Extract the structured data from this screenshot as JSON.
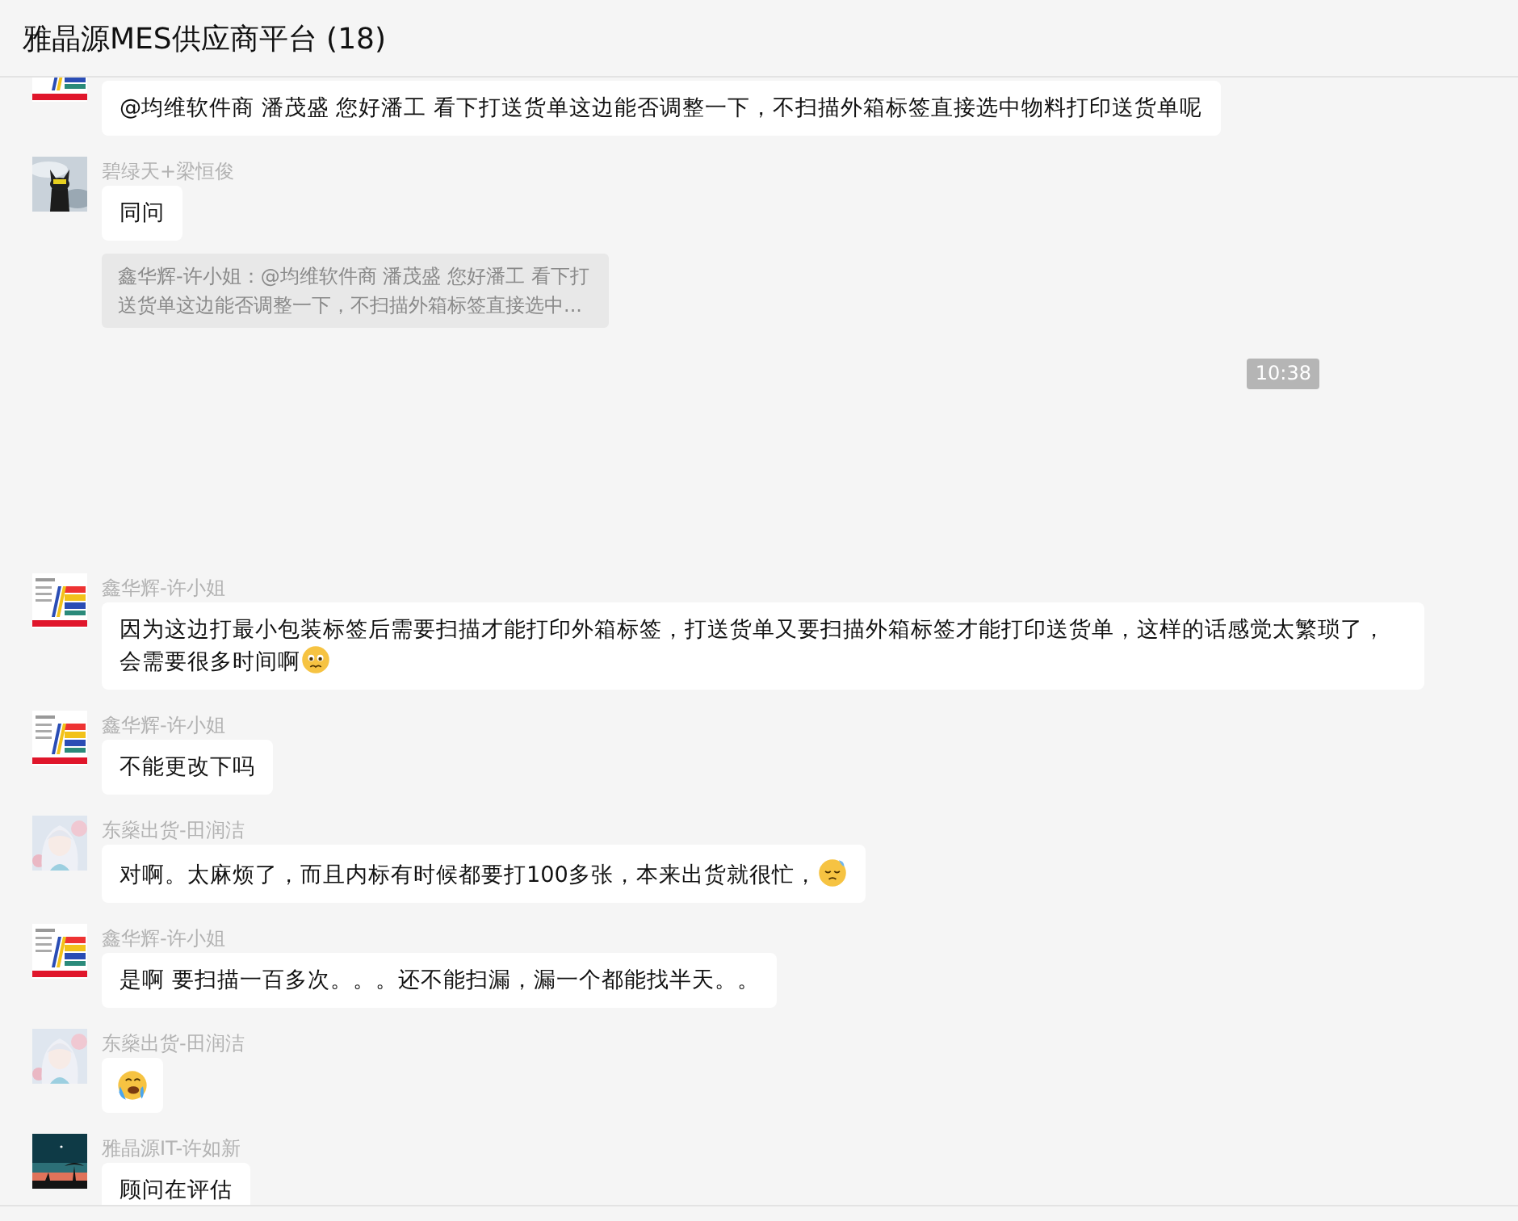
{
  "window": {
    "title": "雅晶源MES供应商平台 (18)"
  },
  "messages": [
    {
      "kind": "message",
      "avatar": {
        "kind": "picture"
      },
      "parts": [
        {
          "kind": "text",
          "text": "@均维软件商 潘茂盛 您好潘工 看下打送货单这边能否调整一下，不扫描外箱标签直接选中物料打印送货单呢"
        }
      ]
    },
    {
      "kind": "message",
      "sender": "碧绿天+梁恒俊",
      "avatar": {
        "kind": "picture"
      },
      "parts": [
        {
          "kind": "text",
          "text": "同问"
        }
      ],
      "quote": "鑫华辉-许小姐：@均维软件商 潘茂盛 您好潘工 看下打送货单这边能否调整一下，不扫描外箱标签直接选中..."
    },
    {
      "kind": "time",
      "text": "10:38"
    },
    {
      "kind": "message",
      "sender": "鑫华辉-许小姐",
      "avatar": {
        "kind": "picture"
      },
      "parts": [
        {
          "kind": "text",
          "text": "因为这边打最小包装标签后需要扫描才能打印外箱标签，打送货单又要扫描外箱标签才能打印送货单，这样的话感觉太繁琐了，会需要很多时间啊"
        },
        {
          "kind": "worried"
        }
      ]
    },
    {
      "kind": "message",
      "sender": "鑫华辉-许小姐",
      "avatar": {
        "kind": "picture"
      },
      "parts": [
        {
          "kind": "text",
          "text": "不能更改下吗"
        }
      ]
    },
    {
      "kind": "message",
      "sender": "东燊出货-田润洁",
      "avatar": {
        "kind": "picture"
      },
      "parts": [
        {
          "kind": "text",
          "text": "对啊。太麻烦了，而且内标有时候都要打100多张，本来出货就很忙，"
        },
        {
          "kind": "sleepy"
        }
      ]
    },
    {
      "kind": "message",
      "sender": "鑫华辉-许小姐",
      "avatar": {
        "kind": "picture"
      },
      "parts": [
        {
          "kind": "text",
          "text": "是啊 要扫描一百多次。。。还不能扫漏，漏一个都能找半天。。"
        }
      ]
    },
    {
      "kind": "message",
      "sender": "东燊出货-田润洁",
      "avatar": {
        "kind": "picture"
      },
      "parts": [
        {
          "kind": "crying"
        }
      ]
    },
    {
      "kind": "message",
      "sender": "雅晶源IT-许如新",
      "avatar": {
        "kind": "picture"
      },
      "parts": [
        {
          "kind": "text",
          "text": "顾问在评估"
        }
      ]
    }
  ]
}
